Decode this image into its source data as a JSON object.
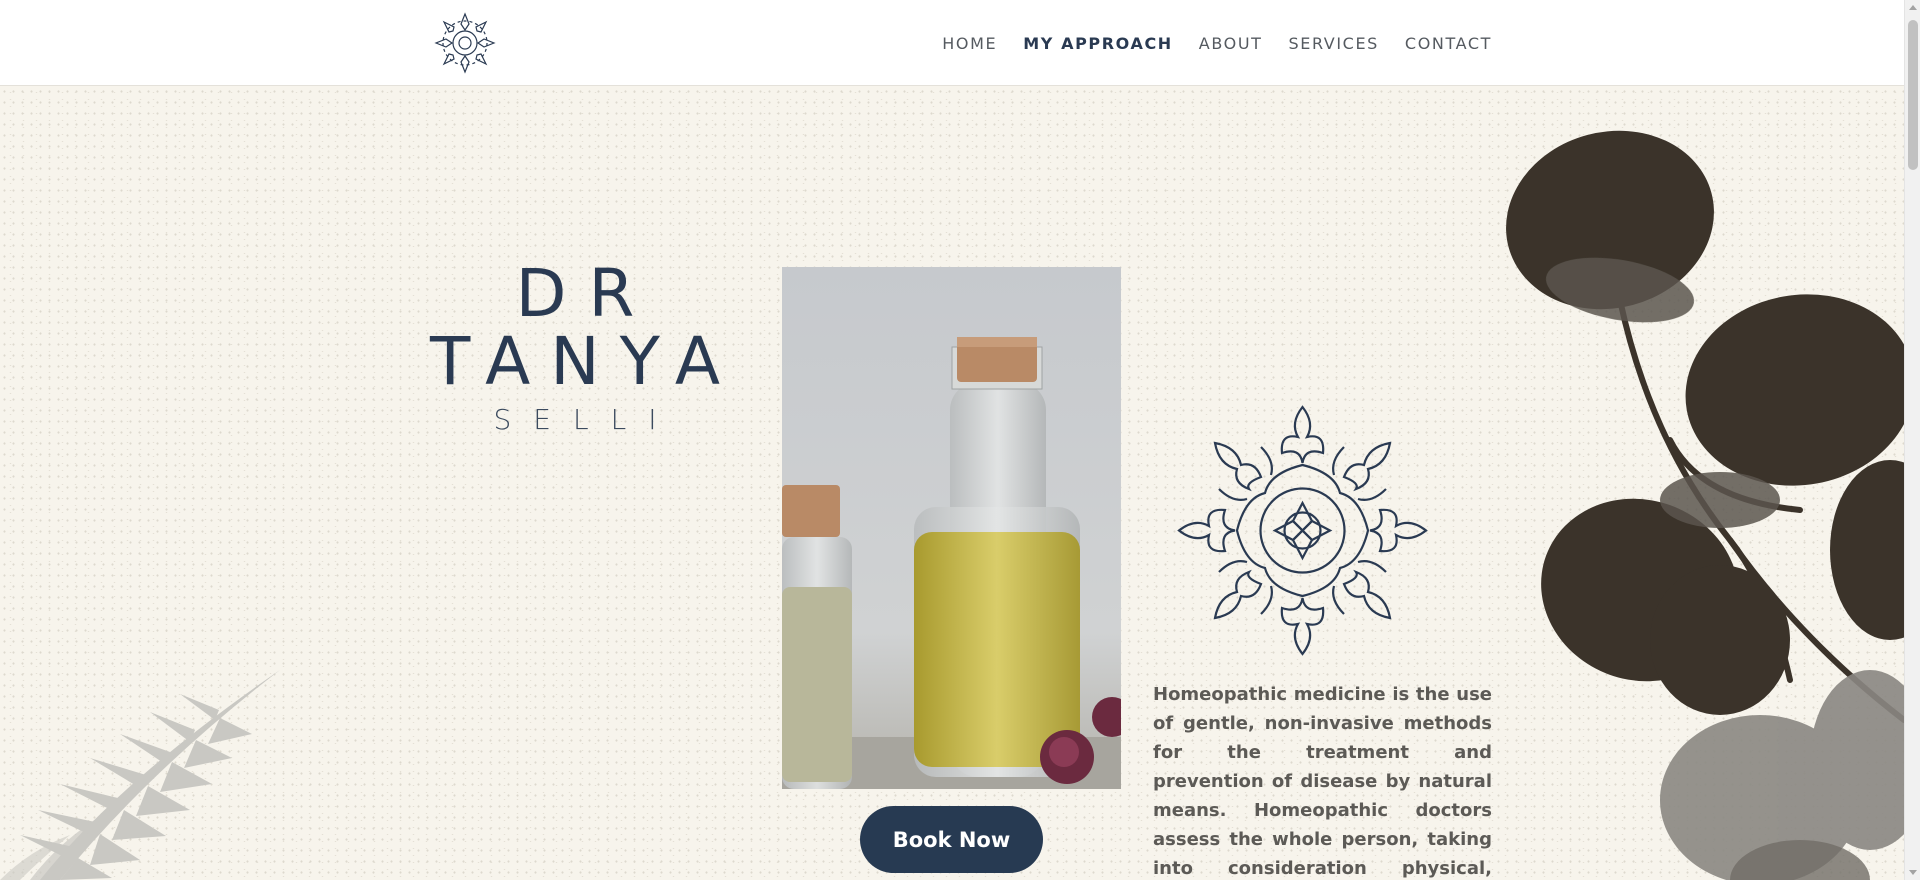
{
  "nav": {
    "items": [
      {
        "label": "HOME",
        "active": false
      },
      {
        "label": "MY APPROACH",
        "active": true
      },
      {
        "label": "ABOUT",
        "active": false
      },
      {
        "label": "SERVICES",
        "active": false
      },
      {
        "label": "CONTACT",
        "active": false
      }
    ]
  },
  "hero": {
    "title_line1": "DR",
    "title_line2": "TANYA",
    "subtitle": "SELLI",
    "cta_label": "Book Now",
    "description": "Homeopathic medicine is the use of gentle, non-invasive methods for the treatment and prevention of disease by natural means. Homeopathic doctors assess the whole person, taking into consideration physical, mental and"
  },
  "icons": {
    "logo": "mandala-logo-icon",
    "decor_mandala": "mandala-icon",
    "decor_plant": "eucalyptus-branch-illustration",
    "decor_fern": "fern-leaf-illustration"
  },
  "colors": {
    "navy": "#273a52",
    "cream_bg": "#f7f4ec",
    "text_grey": "#5c5a56",
    "plant_dark": "#3b332a"
  }
}
